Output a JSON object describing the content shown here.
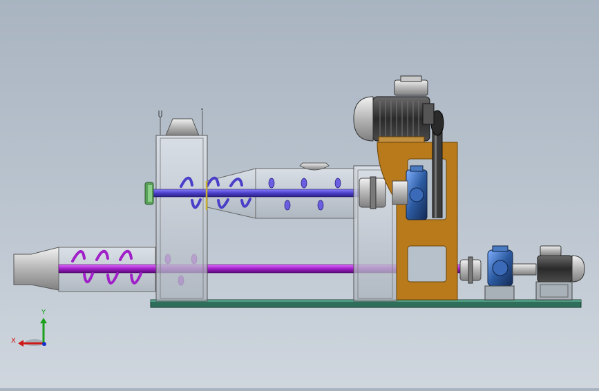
{
  "view": {
    "background_top": "#a9b4c1",
    "background_bottom": "#cfd6de"
  },
  "triad": {
    "x_label": "X",
    "y_label": "Y",
    "x_color": "#d01818",
    "y_color": "#1aa01a",
    "z_color": "#1830c8"
  },
  "colors": {
    "upper_shaft": "#5a4fd0",
    "lower_shaft": "#a020c8",
    "frame": "#b87a1a",
    "base_plate": "#2e6e5a",
    "gearbox": "#2c5aa0",
    "motor_body": "#3a3a3a"
  }
}
